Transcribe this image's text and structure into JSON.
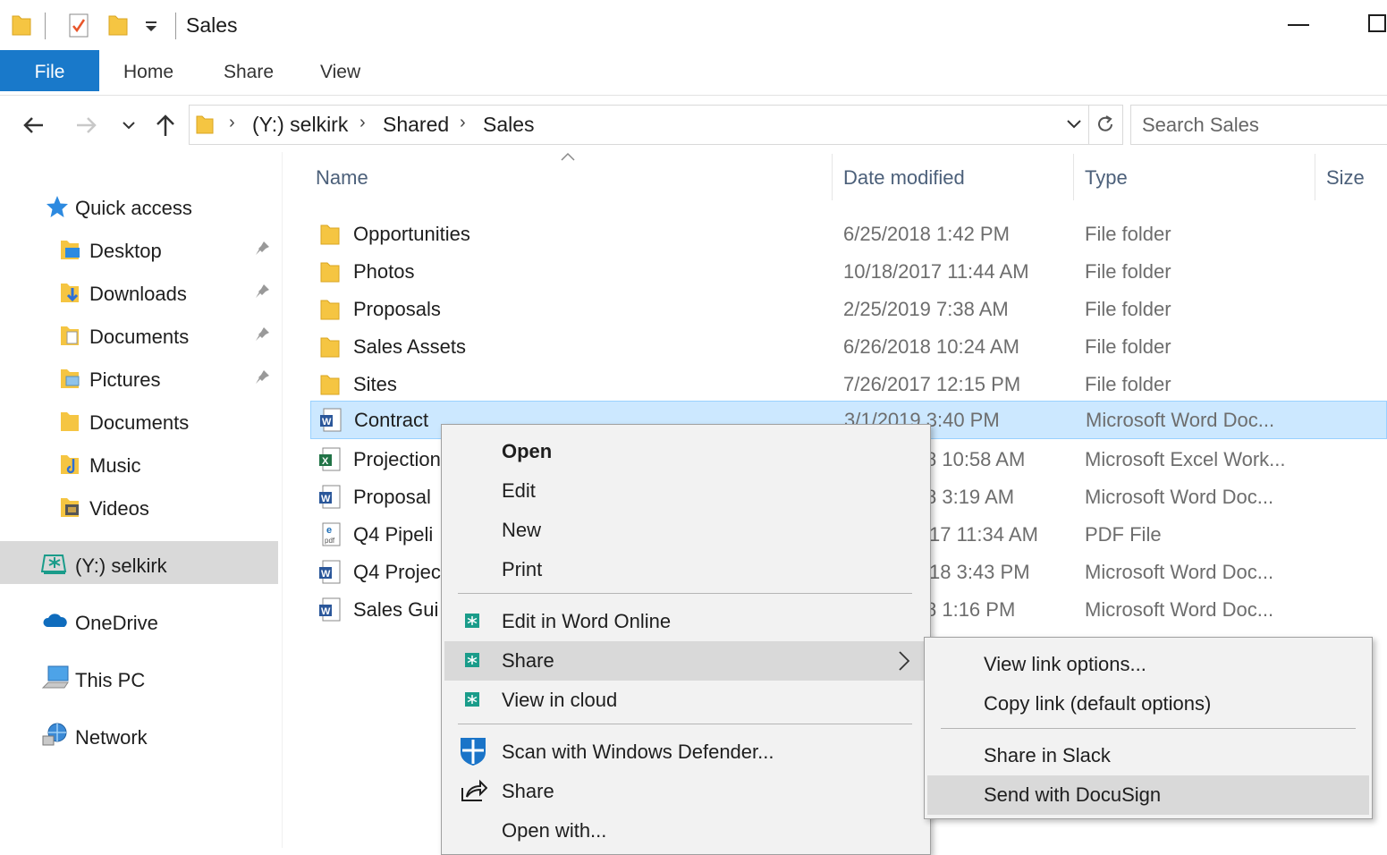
{
  "window": {
    "title": "Sales",
    "controls": {
      "minimize": "minimize-icon",
      "maximize": "maximize-icon"
    }
  },
  "ribbon": {
    "tabs": [
      {
        "label": "File",
        "active": true
      },
      {
        "label": "Home"
      },
      {
        "label": "Share"
      },
      {
        "label": "View"
      }
    ]
  },
  "address": {
    "crumbs": [
      "(Y:) selkirk",
      "Shared",
      "Sales"
    ]
  },
  "search": {
    "placeholder": "Search Sales"
  },
  "nav": {
    "quick_access": "Quick access",
    "items": [
      {
        "label": "Desktop",
        "pinned": true
      },
      {
        "label": "Downloads",
        "pinned": true
      },
      {
        "label": "Documents",
        "pinned": true
      },
      {
        "label": "Pictures",
        "pinned": true
      },
      {
        "label": "Documents"
      },
      {
        "label": "Music"
      },
      {
        "label": "Videos"
      }
    ],
    "drive": "(Y:) selkirk",
    "onedrive": "OneDrive",
    "thispc": "This PC",
    "network": "Network"
  },
  "columns": {
    "name": "Name",
    "date": "Date modified",
    "type": "Type",
    "size": "Size"
  },
  "files": [
    {
      "name": "Opportunities",
      "date": "6/25/2018 1:42 PM",
      "type": "File folder",
      "icon": "folder"
    },
    {
      "name": "Photos",
      "date": "10/18/2017 11:44 AM",
      "type": "File folder",
      "icon": "folder"
    },
    {
      "name": "Proposals",
      "date": "2/25/2019 7:38 AM",
      "type": "File folder",
      "icon": "folder"
    },
    {
      "name": "Sales Assets",
      "date": "6/26/2018 10:24 AM",
      "type": "File folder",
      "icon": "folder"
    },
    {
      "name": "Sites",
      "date": "7/26/2017 12:15 PM",
      "type": "File folder",
      "icon": "folder"
    },
    {
      "name": "Contract",
      "date": "3/1/2019 3:40 PM",
      "type": "Microsoft Word Doc...",
      "icon": "word",
      "selected": true
    },
    {
      "name": "Projection",
      "date": "8 10:58 AM",
      "type": "Microsoft Excel Work...",
      "icon": "excel"
    },
    {
      "name": "Proposal",
      "date": "8 3:19 AM",
      "type": "Microsoft Word Doc...",
      "icon": "word"
    },
    {
      "name": "Q4 Pipeli",
      "date": "17 11:34 AM",
      "type": "PDF File",
      "icon": "pdf"
    },
    {
      "name": "Q4 Projec",
      "date": "18 3:43 PM",
      "type": "Microsoft Word Doc...",
      "icon": "word"
    },
    {
      "name": "Sales Gui",
      "date": "8 1:16 PM",
      "type": "Microsoft Word Doc...",
      "icon": "word"
    }
  ],
  "context_menu": {
    "open": "Open",
    "edit": "Edit",
    "new": "New",
    "print": "Print",
    "edit_word_online": "Edit in Word Online",
    "share_cloud": "Share",
    "view_cloud": "View in cloud",
    "scan": "Scan with Windows Defender...",
    "share": "Share",
    "open_with": "Open with..."
  },
  "submenu": {
    "view_link": "View link options...",
    "copy_link": "Copy link (default options)",
    "slack": "Share in Slack",
    "docusign": "Send with DocuSign"
  },
  "colors": {
    "accent": "#1979ca",
    "selection": "#cce8ff",
    "folder": "#f5c542",
    "word": "#2b579a",
    "excel": "#217346",
    "cloud_drive": "#1a9c8a"
  }
}
